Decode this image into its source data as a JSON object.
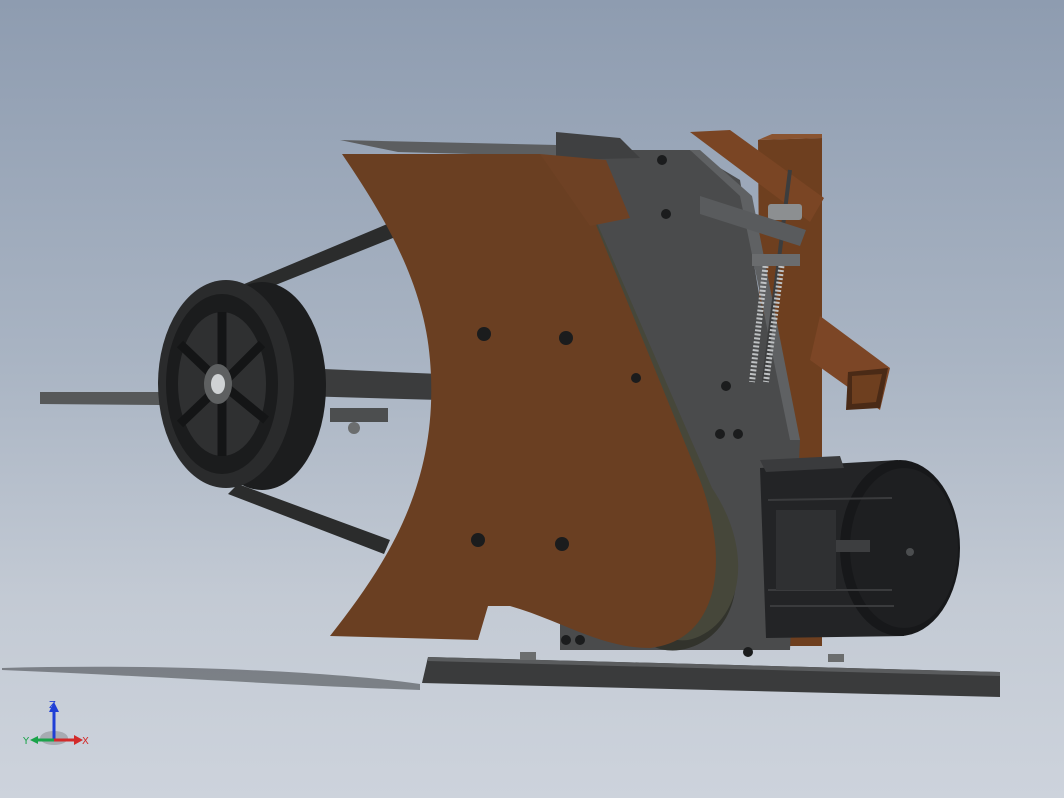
{
  "viewport": {
    "background_top": "#8e9cb0",
    "background_bottom": "#cdd3dc"
  },
  "colors": {
    "guard_brown": "#6a3f22",
    "frame_dark": "#3e3f40",
    "frame_mid": "#545657",
    "belt_dark": "#2c2d2a",
    "motor_black": "#1f2022",
    "rubber": "#161718"
  },
  "triad": {
    "x_label": "X",
    "y_label": "Y",
    "z_label": "Z",
    "x_color": "#d22a2a",
    "y_color": "#1aa34a",
    "z_color": "#1f3fd6"
  }
}
